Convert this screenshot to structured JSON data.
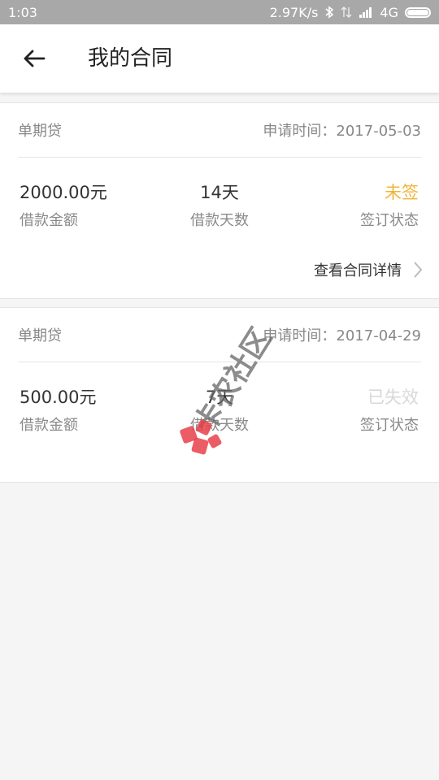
{
  "status_bar": {
    "time": "1:03",
    "speed": "2.97K/s",
    "network": "4G"
  },
  "app_bar": {
    "title": "我的合同"
  },
  "contracts": [
    {
      "type": "单期贷",
      "apply_time": "申请时间：2017-05-03",
      "amount": "2000.00元",
      "amount_label": "借款金额",
      "days": "14天",
      "days_label": "借款天数",
      "status": "未签",
      "status_label": "签订状态",
      "detail_link": "查看合同详情"
    },
    {
      "type": "单期贷",
      "apply_time": "申请时间：2017-04-29",
      "amount": "500.00元",
      "amount_label": "借款金额",
      "days": "7天",
      "days_label": "借款天数",
      "status": "已失效",
      "status_label": "签订状态"
    }
  ],
  "colors": {
    "status_pending": "#f0b53a",
    "status_expired": "#d8d8d8",
    "status_bar_bg": "#a8a8a8"
  },
  "watermark_text": "卡农社区"
}
